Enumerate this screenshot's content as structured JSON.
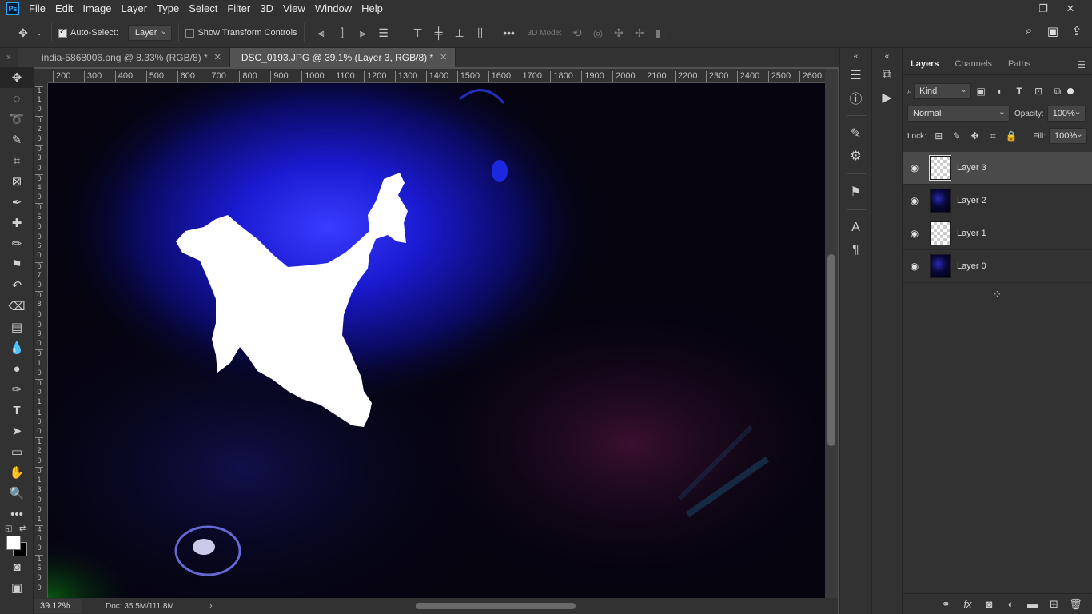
{
  "app": {
    "logo_text": "Ps"
  },
  "menu": [
    "File",
    "Edit",
    "Image",
    "Layer",
    "Type",
    "Select",
    "Filter",
    "3D",
    "View",
    "Window",
    "Help"
  ],
  "window_controls": {
    "minimize": "—",
    "restore": "❐",
    "close": "✕"
  },
  "options_bar": {
    "auto_select_label": "Auto-Select:",
    "auto_select_checked": true,
    "auto_select_target": "Layer",
    "show_transform_label": "Show Transform Controls",
    "show_transform_checked": false,
    "mode_3d_label": "3D Mode:",
    "more_label": "•••"
  },
  "tabs": [
    {
      "label": "india-5868006.png @ 8.33% (RGB/8) *",
      "active": false
    },
    {
      "label": "DSC_0193.JPG @ 39.1% (Layer 3, RGB/8) *",
      "active": true
    }
  ],
  "ruler_top": [
    "200",
    "300",
    "400",
    "500",
    "600",
    "700",
    "800",
    "900",
    "1000",
    "1100",
    "1200",
    "1300",
    "1400",
    "1500",
    "1600",
    "1700",
    "1800",
    "1900",
    "2000",
    "2100",
    "2200",
    "2300",
    "2400",
    "2500",
    "2600"
  ],
  "ruler_left": [
    "1",
    "1",
    "0",
    "0",
    "2",
    "0",
    "0",
    "3",
    "0",
    "0",
    "4",
    "0",
    "0",
    "5",
    "0",
    "0",
    "6",
    "0",
    "0",
    "7",
    "0",
    "0",
    "8",
    "0",
    "0",
    "9",
    "0",
    "0",
    "1",
    "0",
    "0",
    "0",
    "1",
    "1",
    "0",
    "0",
    "1",
    "2",
    "0",
    "0",
    "1",
    "3",
    "0",
    "0",
    "1",
    "4",
    "0",
    "0",
    "1",
    "5",
    "0",
    "0"
  ],
  "status": {
    "zoom": "39.12%",
    "doc": "Doc: 35.5M/111.8M"
  },
  "layers_panel": {
    "tabs": [
      "Layers",
      "Channels",
      "Paths"
    ],
    "active_tab": "Layers",
    "filter_kind": "Kind",
    "blend_mode": "Normal",
    "opacity_label": "Opacity:",
    "opacity_value": "100%",
    "lock_label": "Lock:",
    "fill_label": "Fill:",
    "fill_value": "100%",
    "layers": [
      {
        "name": "Layer 3",
        "selected": true,
        "thumb": "transparent"
      },
      {
        "name": "Layer 2",
        "selected": false,
        "thumb": "image"
      },
      {
        "name": "Layer 1",
        "selected": false,
        "thumb": "transparent"
      },
      {
        "name": "Layer 0",
        "selected": false,
        "thumb": "image"
      }
    ]
  },
  "colors": {
    "accent": "#31a8ff",
    "foreground": "#ffffff",
    "background": "#000000",
    "panel": "#323232",
    "workspace": "#535353"
  }
}
